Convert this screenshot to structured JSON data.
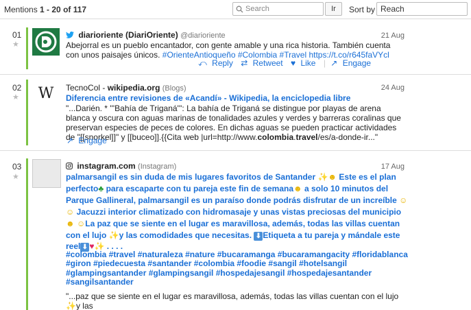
{
  "header": {
    "mentions_label": "Mentions",
    "range": "1 - 20",
    "of_label": "of",
    "total": "117",
    "search_placeholder": "Search",
    "ir_label": "Ir",
    "sort_label": "Sort by",
    "sort_value": "Reach"
  },
  "mentions": [
    {
      "index": "01",
      "source_name": "diarioriente (DiariOriente)",
      "source_handle": "@diarioriente",
      "date": "21 Aug",
      "text": "Abejorral es un pueblo encantador, con gente amable y una rica historia. También cuenta con unos paisajes únicos.",
      "links": "#OrienteAntioqueño #Colombia #Travel https://t.co/r645faVYcl",
      "actions": {
        "reply": "Reply",
        "retweet": "Retweet",
        "like": "Like",
        "engage": "Engage"
      }
    },
    {
      "index": "02",
      "source_name": "TecnoCol",
      "source_sep": "-",
      "source_site": "wikipedia.org",
      "source_type": "(Blogs)",
      "date": "24 Aug",
      "title": "Diferencia entre revisiones de «Acandí» - Wikipedia, la enciclopedia libre",
      "text_a": "\"...Darién. * '''Bahía de Triganá''': La bahía de Triganá se distingue por playas de arena blanca y oscura con aguas marinas de tonalidades azules y verdes y barreras coralinas que preservan especies de peces de colores. En dichas aguas se pueden practicar actividades de \"[[snorkel]]\" y [[buceo]].{{Cita web |url=http://www.",
      "text_b1": "colombia",
      "text_dot": ".",
      "text_b2": "travel",
      "text_c": "/es/a-donde-ir...\"",
      "actions": {
        "engage": "Engage"
      }
    },
    {
      "index": "03",
      "source_site": "instagram.com",
      "source_type": "(Instagram)",
      "date": "17 Aug",
      "caption_1": "palmarsangil es sin duda de mis lugares favoritos de Santander",
      "caption_2": "Este es el plan perfecto",
      "caption_3": "para escaparte con tu pareja este fin de semana",
      "caption_4": "a solo 10 minutos del Parque Gallineral, palmarsangil es un paraíso donde podrás disfrutar de un increíble",
      "caption_5": "Jacuzzi interior climatizado con hidromasaje y unas vistas preciosas del municipio",
      "caption_6": "La paz que se siente en el lugar es maravillosa, además, todas las villas cuentan con el lujo",
      "caption_7": "y las comodidades que necesitas.",
      "caption_8": "Etiqueta a tu pareja y mándale este reel",
      "caption_9": ". . . .",
      "hashtags": "#colombia #travel #naturaleza #nature #bucaramanga #bucaramangacity #floridablanca #giron #piedecuesta #santander #colombia #foodie #sangil #hotelsangil #glampingsantander #glampingsangil #hospedajesangil #hospedajesantander #sangilsantander",
      "excerpt": "\"...paz que se siente en el lugar es maravillosa, además, todas las villas cuentan con el lujo",
      "excerpt_end": "y las"
    }
  ],
  "colors": {
    "accent": "#1a6fd6",
    "green_bar": "#7cc243",
    "logo_green": "#1f7a43"
  }
}
